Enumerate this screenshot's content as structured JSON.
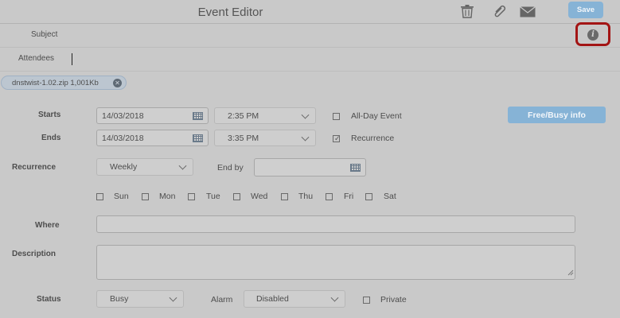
{
  "header": {
    "title": "Event Editor",
    "save_label": "Save",
    "icons": [
      "trash-icon",
      "paperclip-icon",
      "envelope-icon"
    ]
  },
  "subject": {
    "label": "Subject",
    "value": ""
  },
  "attendees": {
    "label": "Attendees",
    "value": ""
  },
  "attachment": {
    "text": "dnstwist-1.02.zip 1,001Kb"
  },
  "starts": {
    "label": "Starts",
    "date": "14/03/2018",
    "time": "2:35 PM"
  },
  "ends": {
    "label": "Ends",
    "date": "14/03/2018",
    "time": "3:35 PM"
  },
  "all_day": {
    "label": "All-Day Event",
    "checked": false
  },
  "recurrence_check": {
    "label": "Recurrence",
    "checked": true
  },
  "free_busy_label": "Free/Busy info",
  "recurrence": {
    "label": "Recurrence",
    "value": "Weekly",
    "end_by_label": "End by",
    "end_by_value": ""
  },
  "days": [
    "Sun",
    "Mon",
    "Tue",
    "Wed",
    "Thu",
    "Fri",
    "Sat"
  ],
  "where": {
    "label": "Where",
    "value": ""
  },
  "description": {
    "label": "Description",
    "value": ""
  },
  "status": {
    "label": "Status",
    "value": "Busy"
  },
  "alarm": {
    "label": "Alarm",
    "value": "Disabled"
  },
  "private": {
    "label": "Private",
    "checked": false
  },
  "colors": {
    "accent": "#86b3d6",
    "highlight": "#a31515",
    "background": "#c9c9c9"
  }
}
